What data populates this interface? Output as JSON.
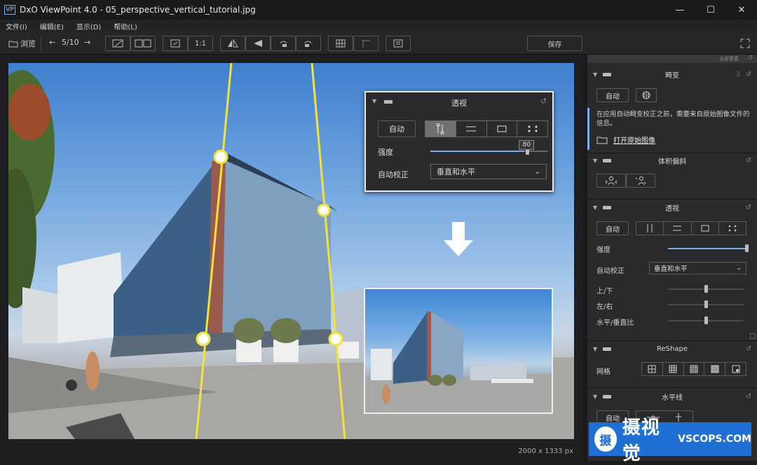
{
  "window": {
    "app_icon": "VP",
    "title": "DxO ViewPoint 4.0 - 05_perspective_vertical_tutorial.jpg",
    "minimize": "—",
    "maximize": "☐",
    "close": "✕"
  },
  "menu": [
    "文件(I)",
    "编辑(E)",
    "显示(D)",
    "帮助(L)"
  ],
  "toolbar": {
    "browse_label": "浏览",
    "prev": "←",
    "counter": "5/10",
    "next": "→",
    "one_to_one": "1:1",
    "save_label": "保存"
  },
  "image_size": "2000 x 1333 px",
  "overlay": {
    "title": "透视",
    "auto_label": "自动",
    "strength_label": "强度",
    "strength_value": "80",
    "strength": 80,
    "auto_correct_label": "自动校正",
    "auto_correct_value": "垂直和水平"
  },
  "panel": {
    "top_strip": "全部重置",
    "vignetting": {
      "title": "畸变",
      "auto_label": "自动",
      "info": "在应用自动畸变校正之前，需要来自原始图像文件的信息。",
      "open_raw": "打开原始图像"
    },
    "volume": {
      "title": "体积偏斜"
    },
    "perspective": {
      "title": "透视",
      "auto_label": "自动",
      "strength_label": "强度",
      "auto_correct_label": "自动校正",
      "auto_correct_value": "垂直和水平",
      "updown_label": "上/下",
      "leftright_label": "左/右",
      "ratio_label": "水平/垂直比",
      "strength": 100,
      "updown": 0.5,
      "leftright": 0.5,
      "ratio": 0.5
    },
    "reshape": {
      "title": "ReShape",
      "grid_label": "网格"
    },
    "horizon": {
      "title": "水平线",
      "auto_label": "自动"
    }
  },
  "watermark": {
    "logo": "摄",
    "cn": "摄视觉",
    "en": "VSCOPS.COM"
  },
  "colors": {
    "accent": "#7aaee8",
    "guide": "#f2e23a",
    "watermark": "#1f6fd4"
  }
}
